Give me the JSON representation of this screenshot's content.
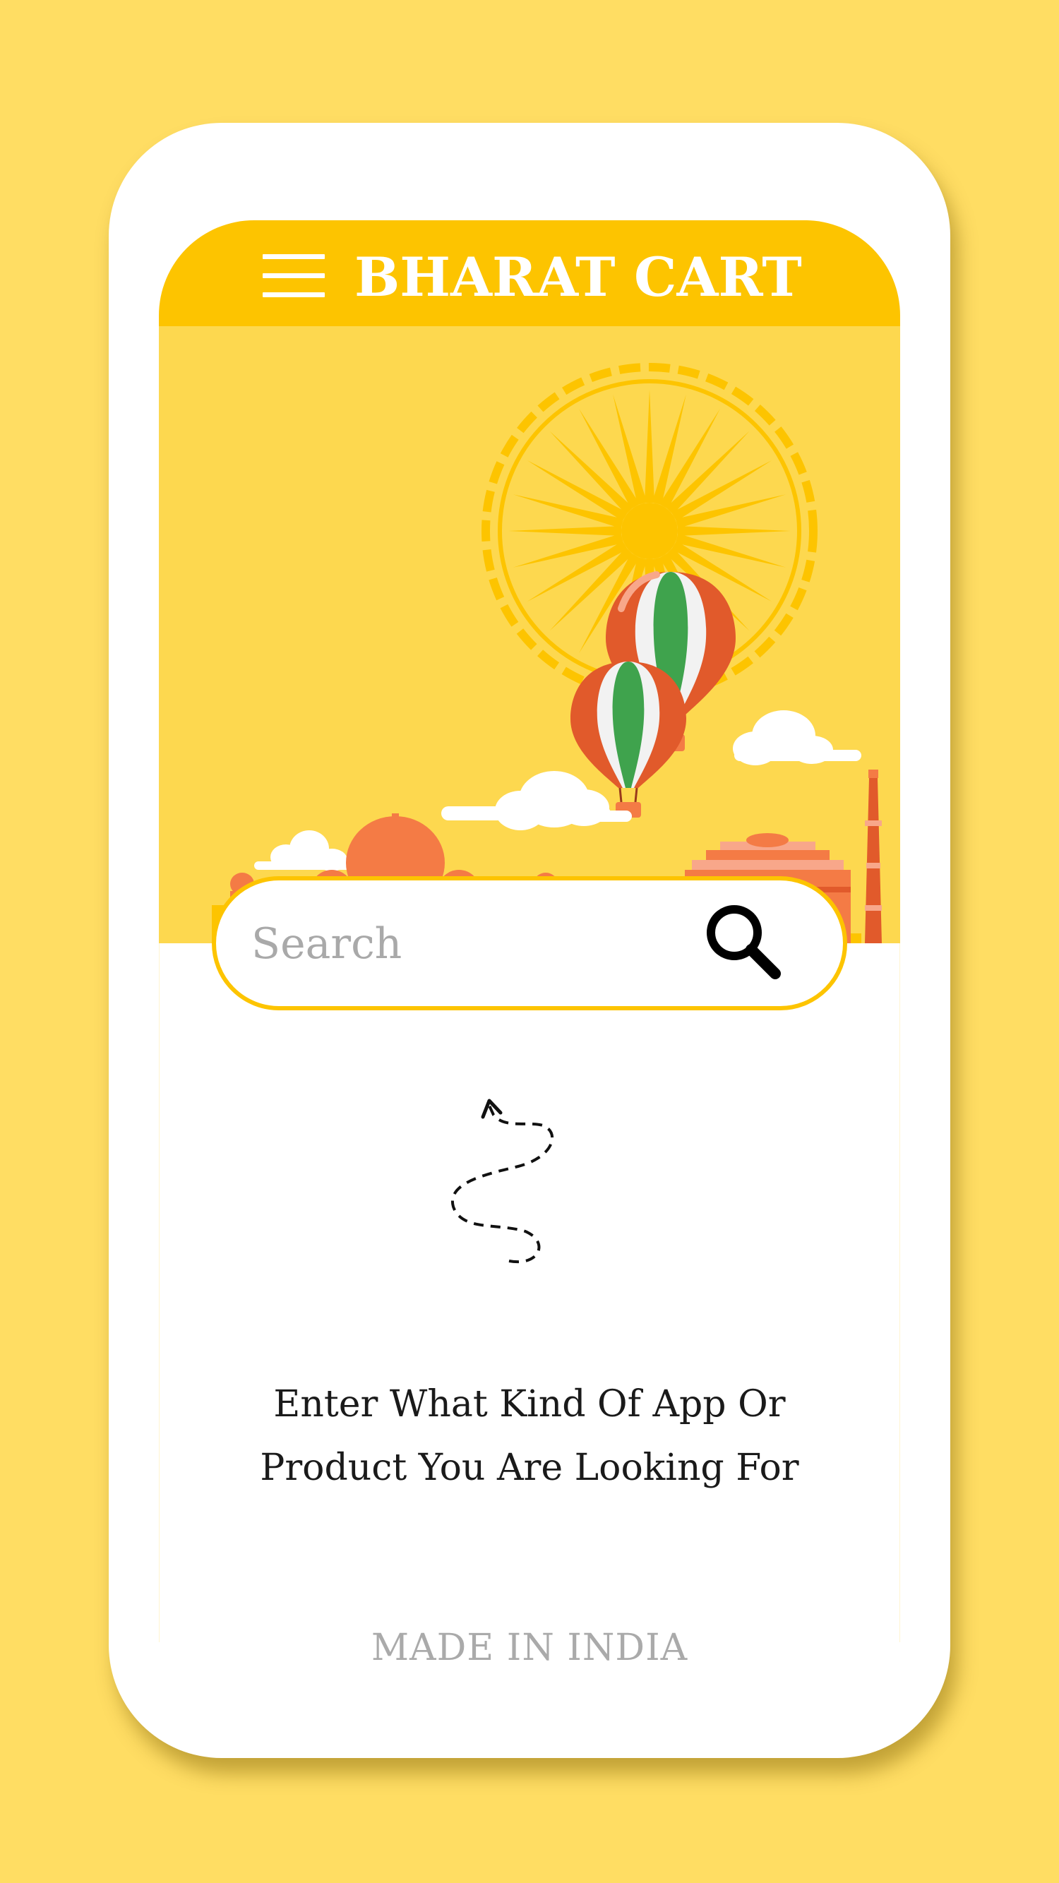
{
  "app": {
    "title": "BHARAT CART",
    "menu_icon": "hamburger-menu-icon"
  },
  "hero": {
    "illustration": "india-landmarks-illustration"
  },
  "search": {
    "placeholder": "Search",
    "value": "",
    "icon": "search-icon"
  },
  "hint": {
    "line1": "Enter What Kind Of App Or",
    "line2": "Product You Are Looking For",
    "icon": "dashed-arrow-icon"
  },
  "footer": {
    "label": "MADE IN INDIA"
  },
  "colors": {
    "background": "#FFDD63",
    "header": "#FDC400",
    "hero": "#FDD84F",
    "saffron": "#F47B45",
    "green": "#3FA34D",
    "footer_text": "#AAAAAA"
  }
}
